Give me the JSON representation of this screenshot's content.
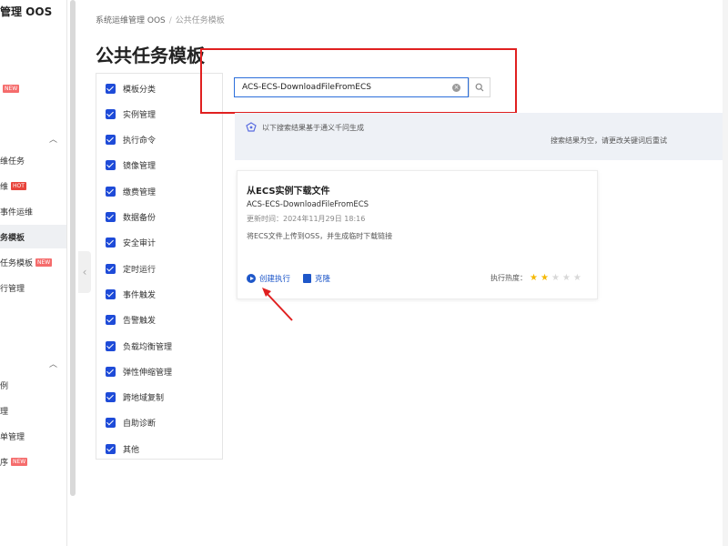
{
  "nav": {
    "title": "管理 OOS",
    "items": [
      {
        "label": "",
        "badge": "NEW",
        "badge_type": "new"
      },
      {
        "label": "维任务"
      },
      {
        "label": "维",
        "badge": "HOT",
        "badge_type": "hot"
      },
      {
        "label": "事件运维"
      },
      {
        "label": "务模板"
      },
      {
        "label": "任务模板",
        "badge": "NEW",
        "badge_type": "new"
      },
      {
        "label": "行管理"
      },
      {
        "label": "例"
      },
      {
        "label": "理"
      },
      {
        "label": "单管理"
      },
      {
        "label": "序",
        "badge": "NEW",
        "badge_type": "new"
      }
    ]
  },
  "breadcrumb": {
    "root": "系统运维管理 OOS",
    "separator": "/",
    "current": "公共任务模板"
  },
  "page_title": "公共任务模板",
  "categories": [
    "模板分类",
    "实例管理",
    "执行命令",
    "镜像管理",
    "缴费管理",
    "数据备份",
    "安全审计",
    "定时运行",
    "事件触发",
    "告警触发",
    "负载均衡管理",
    "弹性伸缩管理",
    "跨地域复制",
    "自助诊断",
    "其他"
  ],
  "search": {
    "value": "ACS-ECS-DownloadFileFromECS"
  },
  "ai_banner": {
    "text": "以下搜索结果基于通义千问生成",
    "empty": "搜索结果为空，请更改关键词后重试"
  },
  "card": {
    "title": "从ECS实例下载文件",
    "code": "ACS-ECS-DownloadFileFromECS",
    "time": "更新时间：2024年11月29日 18:16",
    "desc": "将ECS文件上传到OSS，并生成临时下载链接",
    "run_label": "创建执行",
    "clone_label": "克隆",
    "heat_label": "执行热度：",
    "heat_stars": 2,
    "heat_max": 5
  },
  "colors": {
    "accent": "#1e4bd8",
    "annotation": "#e02020",
    "star": "#f5b800"
  }
}
